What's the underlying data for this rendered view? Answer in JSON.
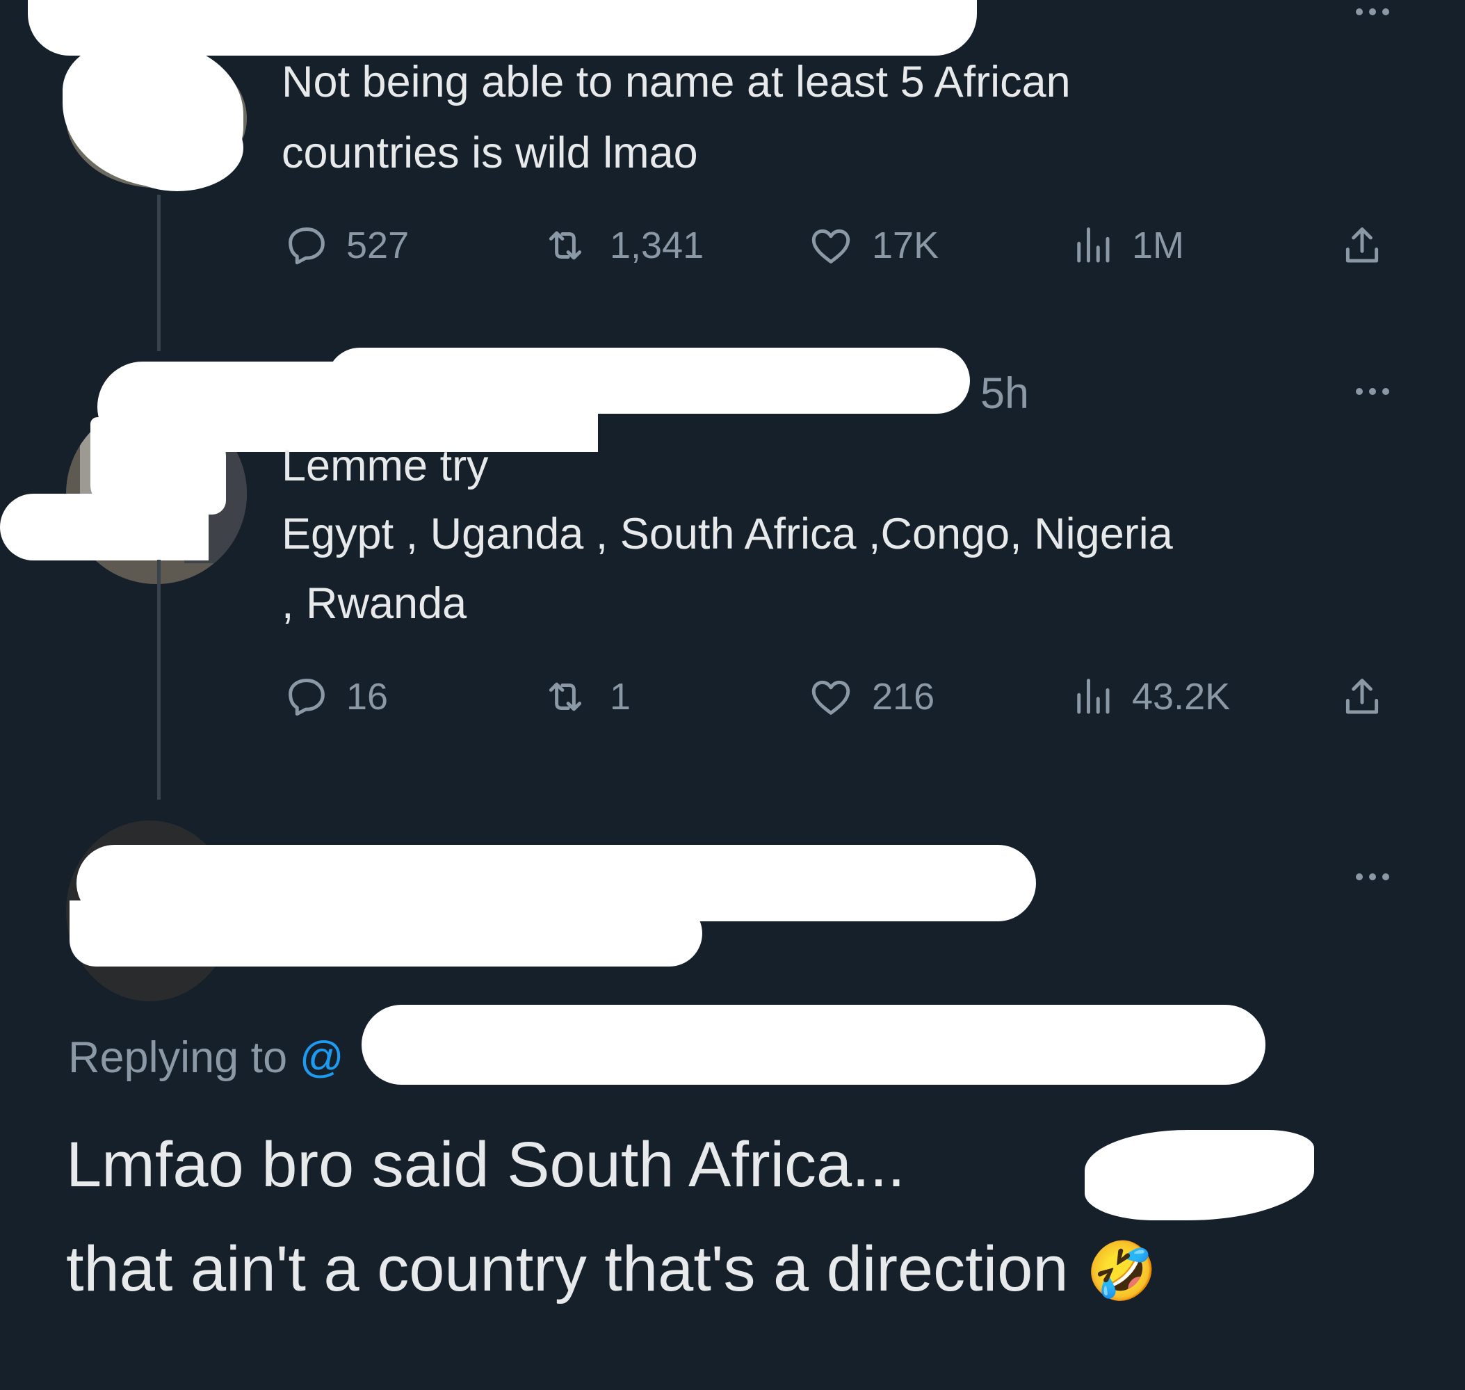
{
  "tweets": [
    {
      "text": [
        "Not being able to name at least 5 African",
        "countries is wild lmao"
      ],
      "stats": {
        "replies": "527",
        "retweets": "1,341",
        "likes": "17K",
        "views": "1M"
      }
    },
    {
      "time": "5h",
      "text": [
        "Lemme try",
        "Egypt , Uganda , South Africa ,Congo, Nigeria",
        ", Rwanda"
      ],
      "stats": {
        "replies": "16",
        "retweets": "1",
        "likes": "216",
        "views": "43.2K"
      }
    }
  ],
  "reply": {
    "replying_to_label": "Replying to",
    "replying_to_prefix": "@",
    "lines": [
      "Lmfao bro said South Africa...",
      "that ain't a country that's a direction"
    ],
    "emoji": "🤣"
  },
  "icons": [
    "reply-icon",
    "retweet-icon",
    "like-icon",
    "views-icon",
    "share-icon",
    "more-icon"
  ],
  "colors": {
    "background": "#15202b",
    "text": "#e7e9ea",
    "muted": "#8b98a5",
    "mention": "#1d9bf0"
  }
}
